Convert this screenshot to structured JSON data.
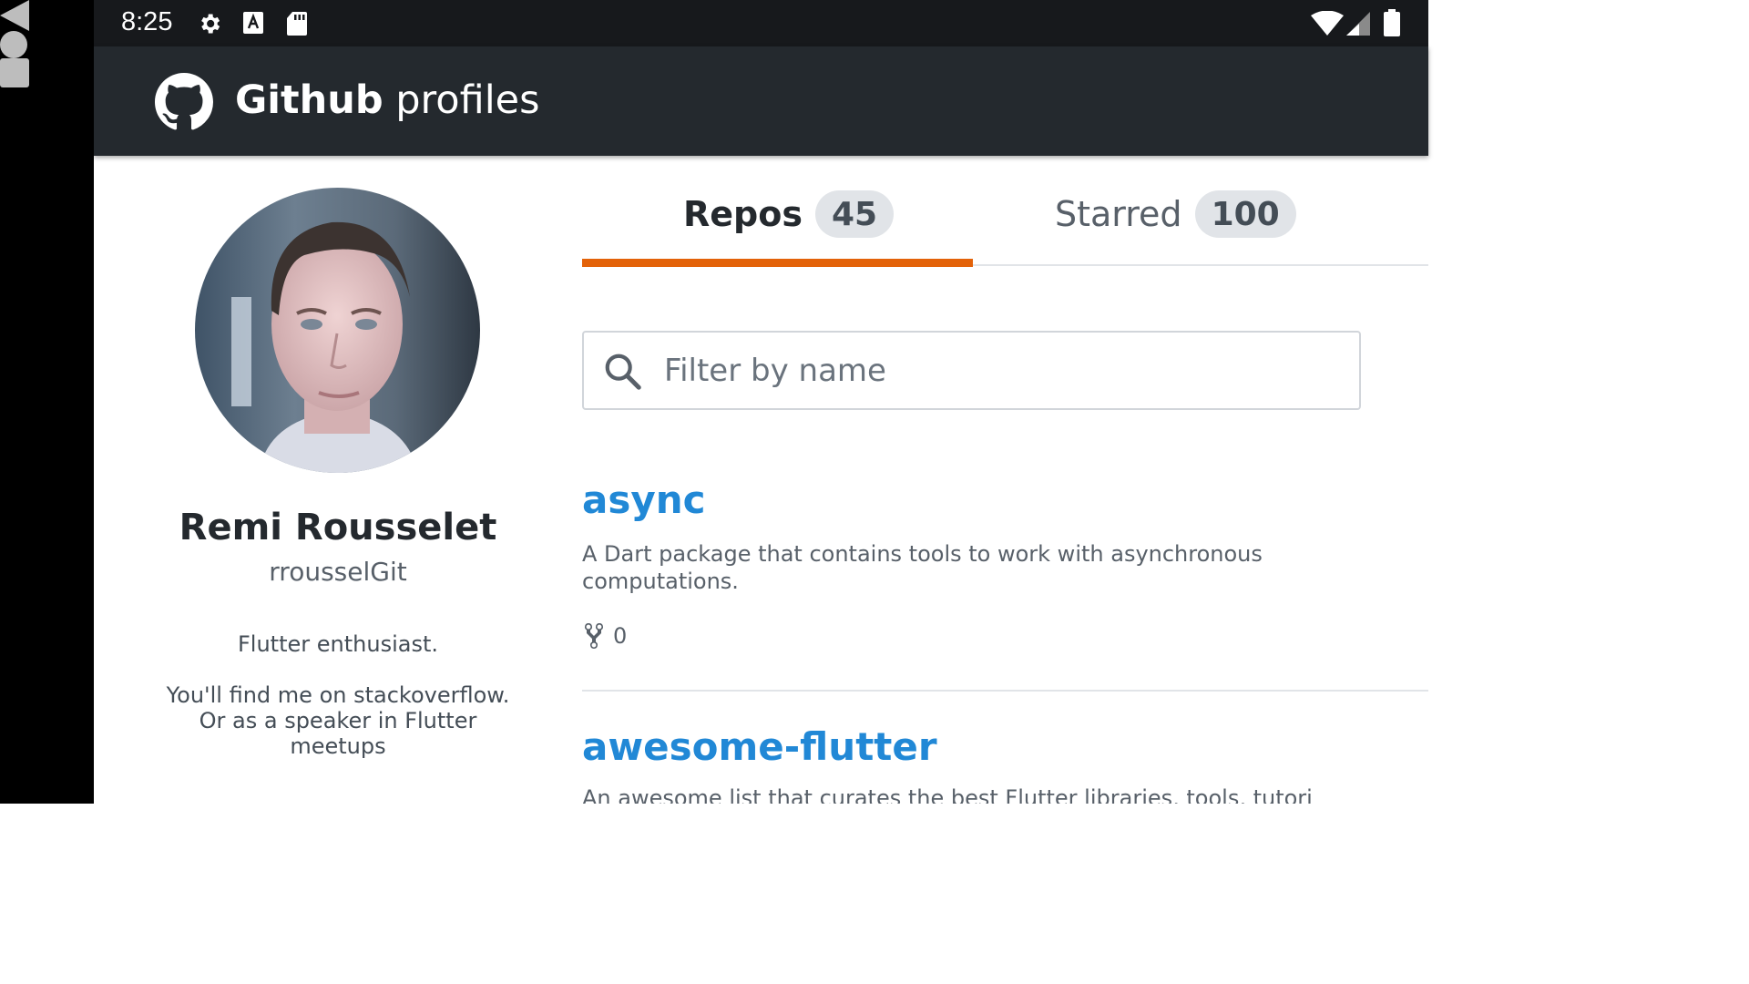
{
  "status_bar": {
    "time": "8:25",
    "icons": [
      "gear-icon",
      "keyboard-a-icon",
      "sd-card-icon",
      "wifi-icon",
      "signal-icon",
      "battery-icon"
    ]
  },
  "nav_bar": {
    "buttons": [
      "back-icon",
      "home-icon",
      "recents-icon"
    ]
  },
  "app_bar": {
    "title_bold": "Github",
    "title_rest": "profiles",
    "logo": "github-logo-icon",
    "background": "#24292e"
  },
  "profile": {
    "name": "Remi Rousselet",
    "login": "rrousselGit",
    "bio_line1": "Flutter enthusiast.",
    "bio_line2": "You'll find me on stackoverflow. Or as a speaker in Flutter meetups"
  },
  "tabs": [
    {
      "label": "Repos",
      "count": "45",
      "selected": true
    },
    {
      "label": "Starred",
      "count": "100",
      "selected": false
    }
  ],
  "colors": {
    "tab_indicator": "#e36209",
    "repo_link": "#2188d6"
  },
  "filter": {
    "placeholder": "Filter by name",
    "value": ""
  },
  "repos": [
    {
      "name": "async",
      "description": "A Dart package that contains tools to work with asynchronous computations.",
      "forks": "0"
    },
    {
      "name": "awesome-flutter",
      "description": "An awesome list that curates the best Flutter libraries, tools, tutorials"
    }
  ]
}
